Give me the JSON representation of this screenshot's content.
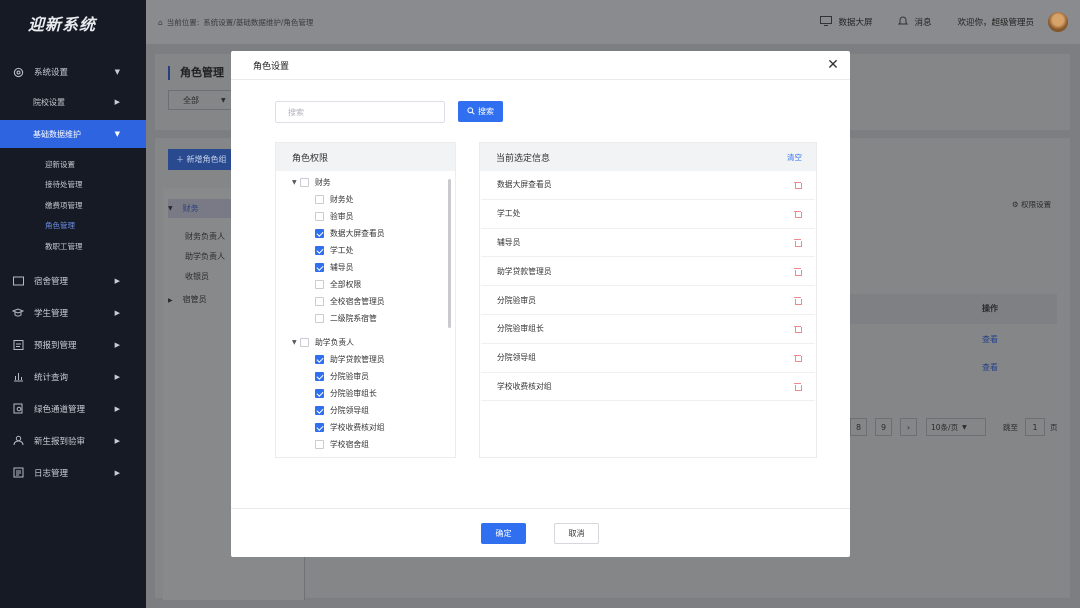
{
  "app": {
    "logo": "迎新系统"
  },
  "topbar": {
    "breadcrumb_prefix": "当前位置:",
    "breadcrumb_path": "系统设置/基础数据维护/角色管理",
    "screen_label": "数据大屏",
    "message_label": "消息",
    "welcome": "欢迎你，超级管理员"
  },
  "sidebar": {
    "system_settings": "系统设置",
    "school_settings": "院校设置",
    "basic_data": "基础数据维护",
    "sub_items": [
      "迎新设置",
      "接待处管理",
      "缴费项管理",
      "角色管理",
      "教职工管理"
    ],
    "menus": [
      "宿舍管理",
      "学生管理",
      "预报到管理",
      "统计查询",
      "绿色通道管理",
      "新生报到验审",
      "日志管理"
    ]
  },
  "background": {
    "page_title": "角色管理",
    "filter_value": "全部",
    "add_role": "新增角色组",
    "group_finance": "财务",
    "group_items": [
      "财务负责人",
      "助学负责人",
      "收银员"
    ],
    "group_dorm": "宿管员",
    "permission_settings": "权限设置",
    "col_action": "操作",
    "view_link": "查看",
    "pages": [
      "8",
      "9"
    ],
    "page_size": "10条/页",
    "jump_label": "跳至",
    "jump_value": "1",
    "page_suffix": "页"
  },
  "modal": {
    "title": "角色设置",
    "search_placeholder": "搜索",
    "search_button": "搜索",
    "left_title": "角色权限",
    "right_title": "当前选定信息",
    "clear": "清空",
    "tree": [
      {
        "label": "财务",
        "checked": false,
        "children": [
          {
            "label": "财务处",
            "checked": false
          },
          {
            "label": "验审员",
            "checked": false
          },
          {
            "label": "数据大屏查看员",
            "checked": true
          },
          {
            "label": "学工处",
            "checked": true
          },
          {
            "label": "辅导员",
            "checked": true
          },
          {
            "label": "全部权限",
            "checked": false
          },
          {
            "label": "全校宿舍管理员",
            "checked": false
          },
          {
            "label": "二级院系宿管",
            "checked": false
          }
        ]
      },
      {
        "label": "助学负责人",
        "checked": false,
        "children": [
          {
            "label": "助学贷款管理员",
            "checked": true
          },
          {
            "label": "分院验审员",
            "checked": true
          },
          {
            "label": "分院验审组长",
            "checked": true
          },
          {
            "label": "分院领导组",
            "checked": true
          },
          {
            "label": "学校收费核对组",
            "checked": true
          },
          {
            "label": "学校宿舍组",
            "checked": false
          }
        ]
      }
    ],
    "selected": [
      "数据大屏查看员",
      "学工处",
      "辅导员",
      "助学贷款管理员",
      "分院验审员",
      "分院验审组长",
      "分院领导组",
      "学校收费核对组"
    ],
    "ok": "确定",
    "cancel": "取消"
  },
  "colors": {
    "primary": "#2f6ff0",
    "sidebar_bg": "#151a24",
    "danger_icon": "#f08a8a"
  }
}
